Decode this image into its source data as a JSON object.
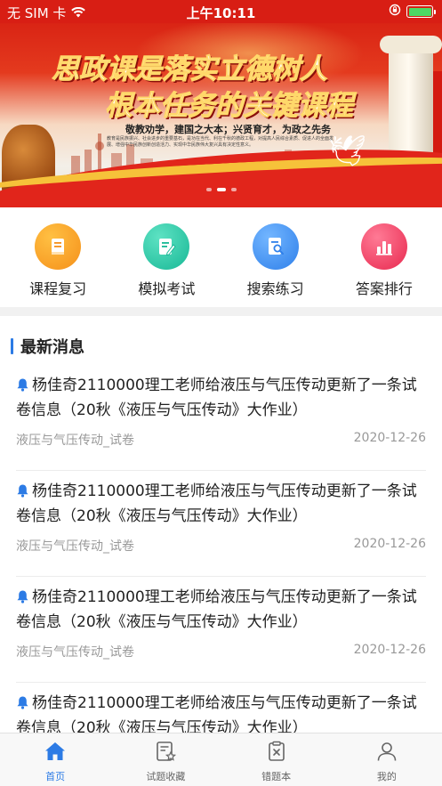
{
  "status_bar": {
    "carrier": "无 SIM 卡",
    "time": "上午10:11",
    "battery_level": 1.0
  },
  "banner": {
    "headline_line1": "思政课是落实立德树人",
    "headline_line2": "根本任务的关键课程",
    "slogan": "敬教劝学，建国之大本；兴贤育才，为政之先务",
    "fine_print": "教育是民族振兴、社会进步的重要基石，是功在当代、利在千秋的德政工程，对提高人民综合素质、促进人的全面发展、增强中华民族创新创造活力、实现中华民族伟大复兴具有决定性意义。",
    "page_count": 3,
    "active_page": 2
  },
  "quick_nav": [
    {
      "label": "课程复习",
      "icon": "book-icon",
      "color": "#f59b1f"
    },
    {
      "label": "模拟考试",
      "icon": "edit-document-icon",
      "color": "#22c3a3"
    },
    {
      "label": "搜索练习",
      "icon": "search-document-icon",
      "color": "#3d8ef0"
    },
    {
      "label": "答案排行",
      "icon": "bar-chart-icon",
      "color": "#ef3f63"
    }
  ],
  "news": {
    "title": "最新消息",
    "items": [
      {
        "text": "杨佳奇2110000理工老师给液压与气压传动更新了一条试卷信息（20秋《液压与气压传动》大作业）",
        "category": "液压与气压传动_试卷",
        "date": "2020-12-26"
      },
      {
        "text": "杨佳奇2110000理工老师给液压与气压传动更新了一条试卷信息（20秋《液压与气压传动》大作业）",
        "category": "液压与气压传动_试卷",
        "date": "2020-12-26"
      },
      {
        "text": "杨佳奇2110000理工老师给液压与气压传动更新了一条试卷信息（20秋《液压与气压传动》大作业）",
        "category": "液压与气压传动_试卷",
        "date": "2020-12-26"
      },
      {
        "text": "杨佳奇2110000理工老师给液压与气压传动更新了一条试卷信息（20秋《液压与气压传动》大作业）",
        "category": "",
        "date": ""
      }
    ]
  },
  "tab_bar": [
    {
      "label": "首页",
      "icon": "home-icon",
      "active": true
    },
    {
      "label": "试题收藏",
      "icon": "favorites-icon",
      "active": false
    },
    {
      "label": "错题本",
      "icon": "wrong-questions-icon",
      "active": false
    },
    {
      "label": "我的",
      "icon": "profile-icon",
      "active": false
    }
  ],
  "colors": {
    "accent": "#2c7be5",
    "banner_red": "#d81e14"
  }
}
